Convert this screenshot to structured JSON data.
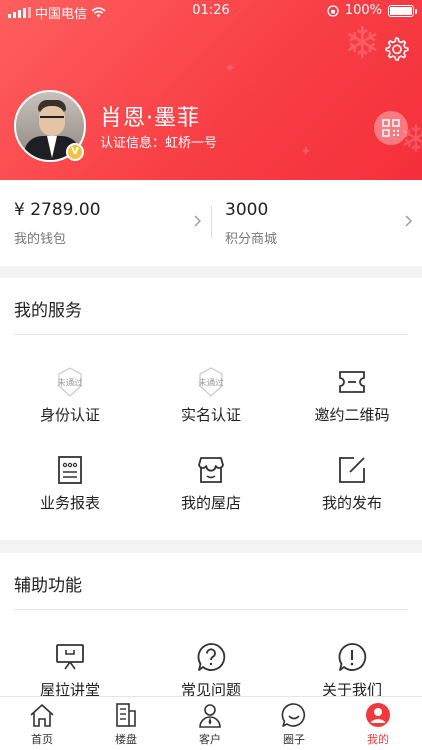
{
  "status_bar": {
    "carrier": "中国电信",
    "time": "01:26",
    "battery": "100%",
    "battery_level": 1.0
  },
  "profile": {
    "name": "肖恩·墨菲",
    "cert_info": "认证信息：虹桥一号",
    "badge": "V"
  },
  "wallet": {
    "balance": "¥ 2789.00",
    "balance_label": "我的钱包",
    "points": "3000",
    "points_label": "积分商城"
  },
  "services": {
    "title": "我的服务",
    "items": [
      {
        "label": "身份认证",
        "icon": "shield-not-passed-icon",
        "badge": "未通过"
      },
      {
        "label": "实名认证",
        "icon": "shield-not-passed-icon",
        "badge": "未通过"
      },
      {
        "label": "邀约二维码",
        "icon": "ticket-icon"
      },
      {
        "label": "业务报表",
        "icon": "report-icon"
      },
      {
        "label": "我的屋店",
        "icon": "store-icon"
      },
      {
        "label": "我的发布",
        "icon": "edit-icon"
      }
    ]
  },
  "assist": {
    "title": "辅助功能",
    "items": [
      {
        "label": "屋拉讲堂",
        "icon": "lecture-icon"
      },
      {
        "label": "常见问题",
        "icon": "question-icon"
      },
      {
        "label": "关于我们",
        "icon": "info-icon"
      }
    ]
  },
  "tabbar": {
    "items": [
      {
        "label": "首页",
        "icon": "home-icon"
      },
      {
        "label": "楼盘",
        "icon": "building-icon"
      },
      {
        "label": "客户",
        "icon": "customer-icon"
      },
      {
        "label": "圈子",
        "icon": "chat-icon"
      },
      {
        "label": "我的",
        "icon": "profile-icon",
        "active": true
      }
    ]
  },
  "colors": {
    "accent": "#f2373f",
    "header_start": "#ff5f5f",
    "header_end": "#f52f3b"
  }
}
